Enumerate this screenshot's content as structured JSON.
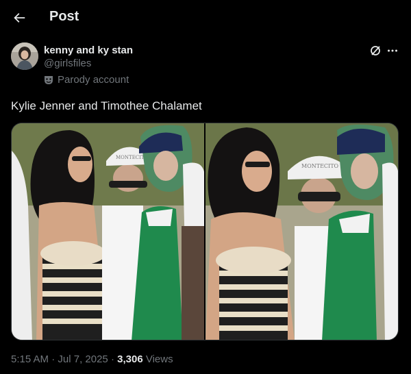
{
  "header": {
    "title": "Post",
    "back_icon": "arrow-left-icon"
  },
  "author": {
    "display_name": "kenny and ky stan",
    "handle": "@girlsfiles",
    "label": "Parody account",
    "label_icon": "theater-masks-icon",
    "avatar_icon": "avatar-photo"
  },
  "actions": {
    "grok_icon": "grok-icon",
    "more_icon": "more-horizontal-icon"
  },
  "post": {
    "text": "Kylie Jenner and Timothee Chalamet"
  },
  "media": {
    "photos": [
      {
        "alt": "photo-1",
        "cap_text": "MONTECITO"
      },
      {
        "alt": "photo-2",
        "cap_text": "MONTECITO"
      }
    ]
  },
  "meta": {
    "time": "5:15 AM",
    "sep1": "·",
    "date": "Jul 7, 2025",
    "sep2": "·",
    "views_count": "3,306",
    "views_label": "Views"
  },
  "colors": {
    "background": "#000000",
    "text": "#e7e9ea",
    "muted": "#71767b",
    "border": "#2f3336"
  }
}
